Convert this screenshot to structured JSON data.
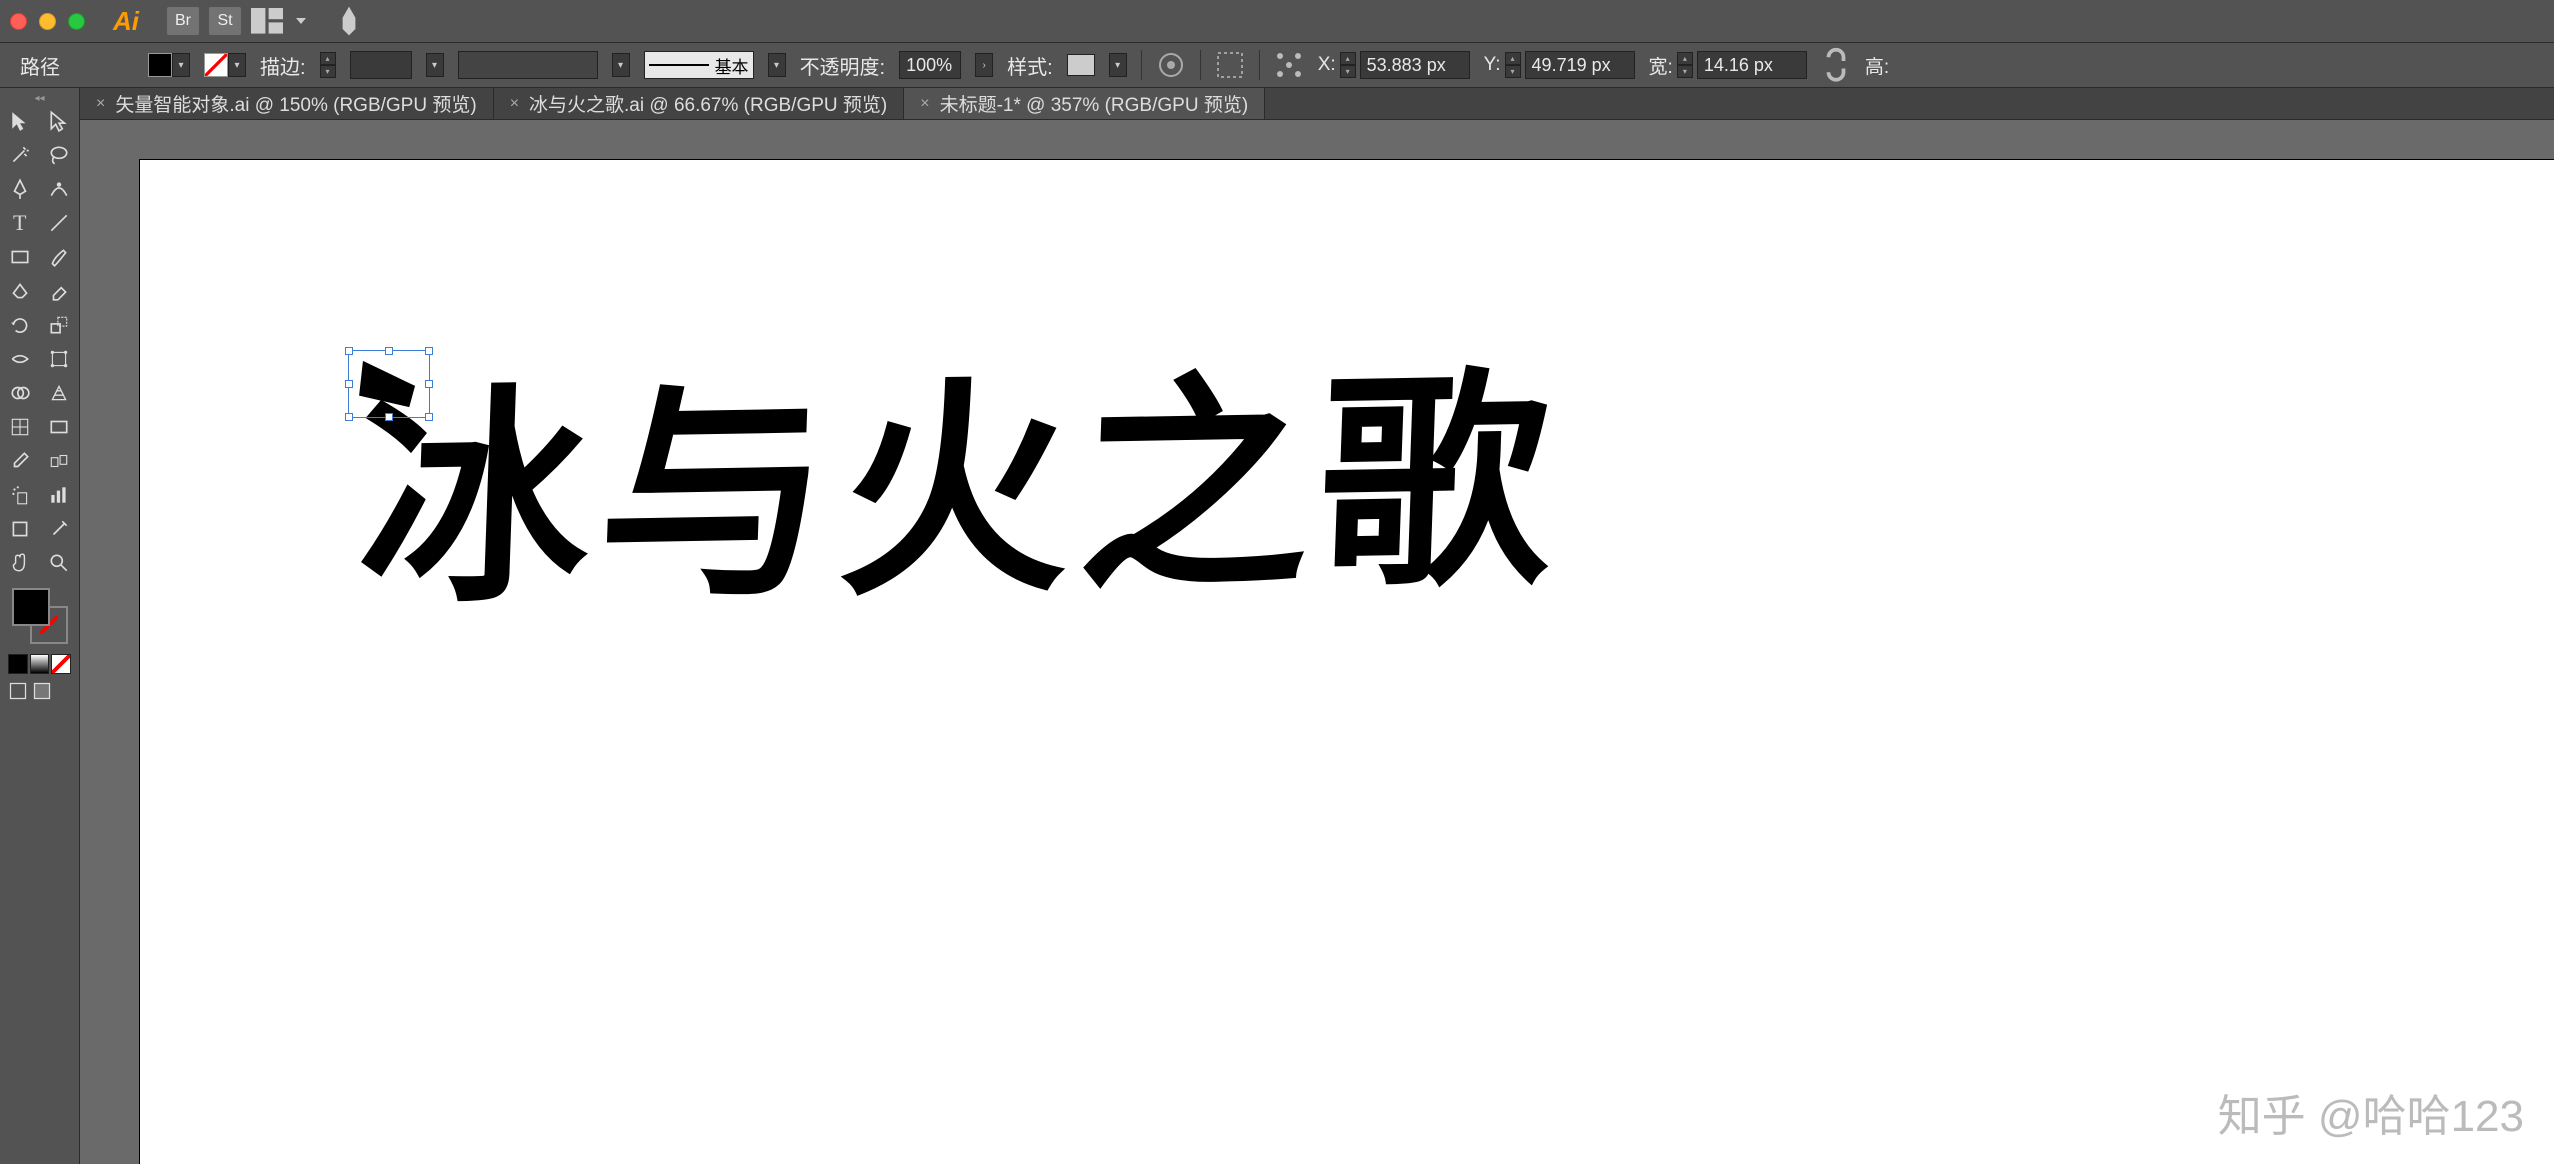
{
  "topbar": {
    "app_logo": "Ai",
    "bridge_label": "Br",
    "stock_label": "St"
  },
  "controlbar": {
    "path_label": "路径",
    "stroke_label": "描边:",
    "stroke_weight": "",
    "stroke_style_label": "基本",
    "opacity_label": "不透明度:",
    "opacity_value": "100%",
    "style_label": "样式:",
    "x_label": "X:",
    "x_value": "53.883 px",
    "y_label": "Y:",
    "y_value": "49.719 px",
    "w_label": "宽:",
    "w_value": "14.16 px",
    "h_label": "高:"
  },
  "tabs": [
    {
      "label": "矢量智能对象.ai @ 150% (RGB/GPU 预览)",
      "active": false
    },
    {
      "label": "冰与火之歌.ai @ 66.67% (RGB/GPU 预览)",
      "active": false
    },
    {
      "label": "未标题-1* @ 357% (RGB/GPU 预览)",
      "active": true
    }
  ],
  "canvas": {
    "artwork_text": "冰与火之歌",
    "watermark": "知乎 @哈哈123"
  },
  "tool_names": [
    [
      "selection",
      "direct-selection"
    ],
    [
      "magic-wand",
      "lasso"
    ],
    [
      "pen",
      "curvature"
    ],
    [
      "type",
      "line-segment"
    ],
    [
      "rectangle",
      "paintbrush"
    ],
    [
      "shaper",
      "eraser"
    ],
    [
      "rotate",
      "scale"
    ],
    [
      "width",
      "free-transform"
    ],
    [
      "shape-builder",
      "perspective"
    ],
    [
      "mesh",
      "gradient"
    ],
    [
      "eyedropper",
      "blend"
    ],
    [
      "symbol-sprayer",
      "column-graph"
    ],
    [
      "artboard",
      "slice"
    ],
    [
      "hand",
      "zoom"
    ]
  ]
}
